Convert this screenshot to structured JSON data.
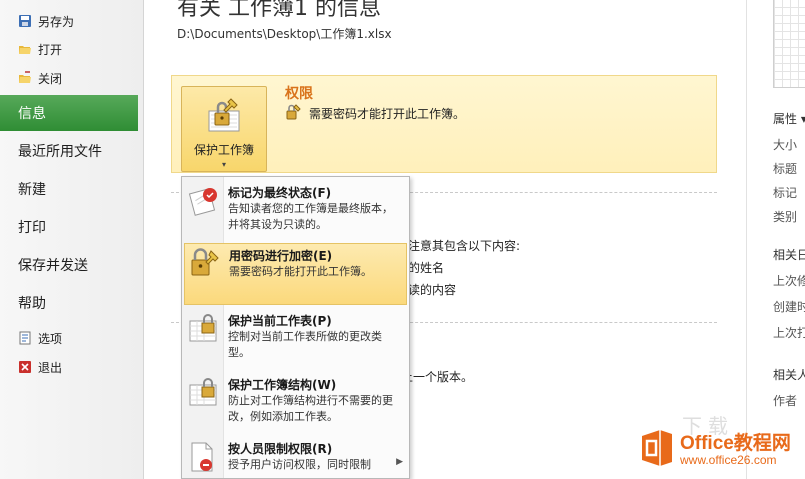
{
  "nav": {
    "top_items": [
      {
        "label": "另存为",
        "icon": "save-as-icon"
      },
      {
        "label": "打开",
        "icon": "open-folder-icon"
      },
      {
        "label": "关闭",
        "icon": "close-folder-icon"
      }
    ],
    "main_items": [
      "信息",
      "最近所用文件",
      "新建",
      "打印",
      "保存并发送",
      "帮助"
    ],
    "active": "信息",
    "bottom_items": [
      {
        "label": "选项",
        "icon": "options-icon"
      },
      {
        "label": "退出",
        "icon": "exit-icon"
      }
    ],
    "accent": "#3a9640"
  },
  "main": {
    "title": "有关 工作簿1 的信息",
    "path": "D:\\Documents\\Desktop\\工作簿1.xlsx",
    "permissions": {
      "button_label": "保护工作簿",
      "heading": "权限",
      "description": "需要密码才能打开此工作簿。"
    },
    "partial_text": {
      "line1": "注意其包含以下内容:",
      "line2": "的姓名",
      "line3": "读的内容",
      "line4": "上一个版本。"
    }
  },
  "menu": {
    "items": [
      {
        "title": "标记为最终状态(F)",
        "desc": "告知读者您的工作簿是最终版本，并将其设为只读的。",
        "icon": "mark-final-icon"
      },
      {
        "title": "用密码进行加密(E)",
        "desc": "需要密码才能打开此工作簿。",
        "icon": "encrypt-lock-icon",
        "highlighted": true
      },
      {
        "title": "保护当前工作表(P)",
        "desc": "控制对当前工作表所做的更改类型。",
        "icon": "protect-sheet-icon"
      },
      {
        "title": "保护工作簿结构(W)",
        "desc": "防止对工作簿结构进行不需要的更改，例如添加工作表。",
        "icon": "protect-structure-icon"
      },
      {
        "title": "按人员限制权限(R)",
        "desc": "授予用户访问权限，同时限制",
        "icon": "restrict-permission-icon",
        "has_submenu": true
      }
    ]
  },
  "right": {
    "properties_label": "属性 ▾",
    "items": [
      "大小",
      "标题",
      "标记",
      "类别"
    ],
    "related_dates": "相关日",
    "dates": [
      "上次修",
      "创建时",
      "上次打"
    ],
    "related_people": "相关人",
    "author": "作者"
  },
  "watermark": {
    "brand": "Office教程网",
    "url": "www.office26.com",
    "ghost": "下载"
  }
}
